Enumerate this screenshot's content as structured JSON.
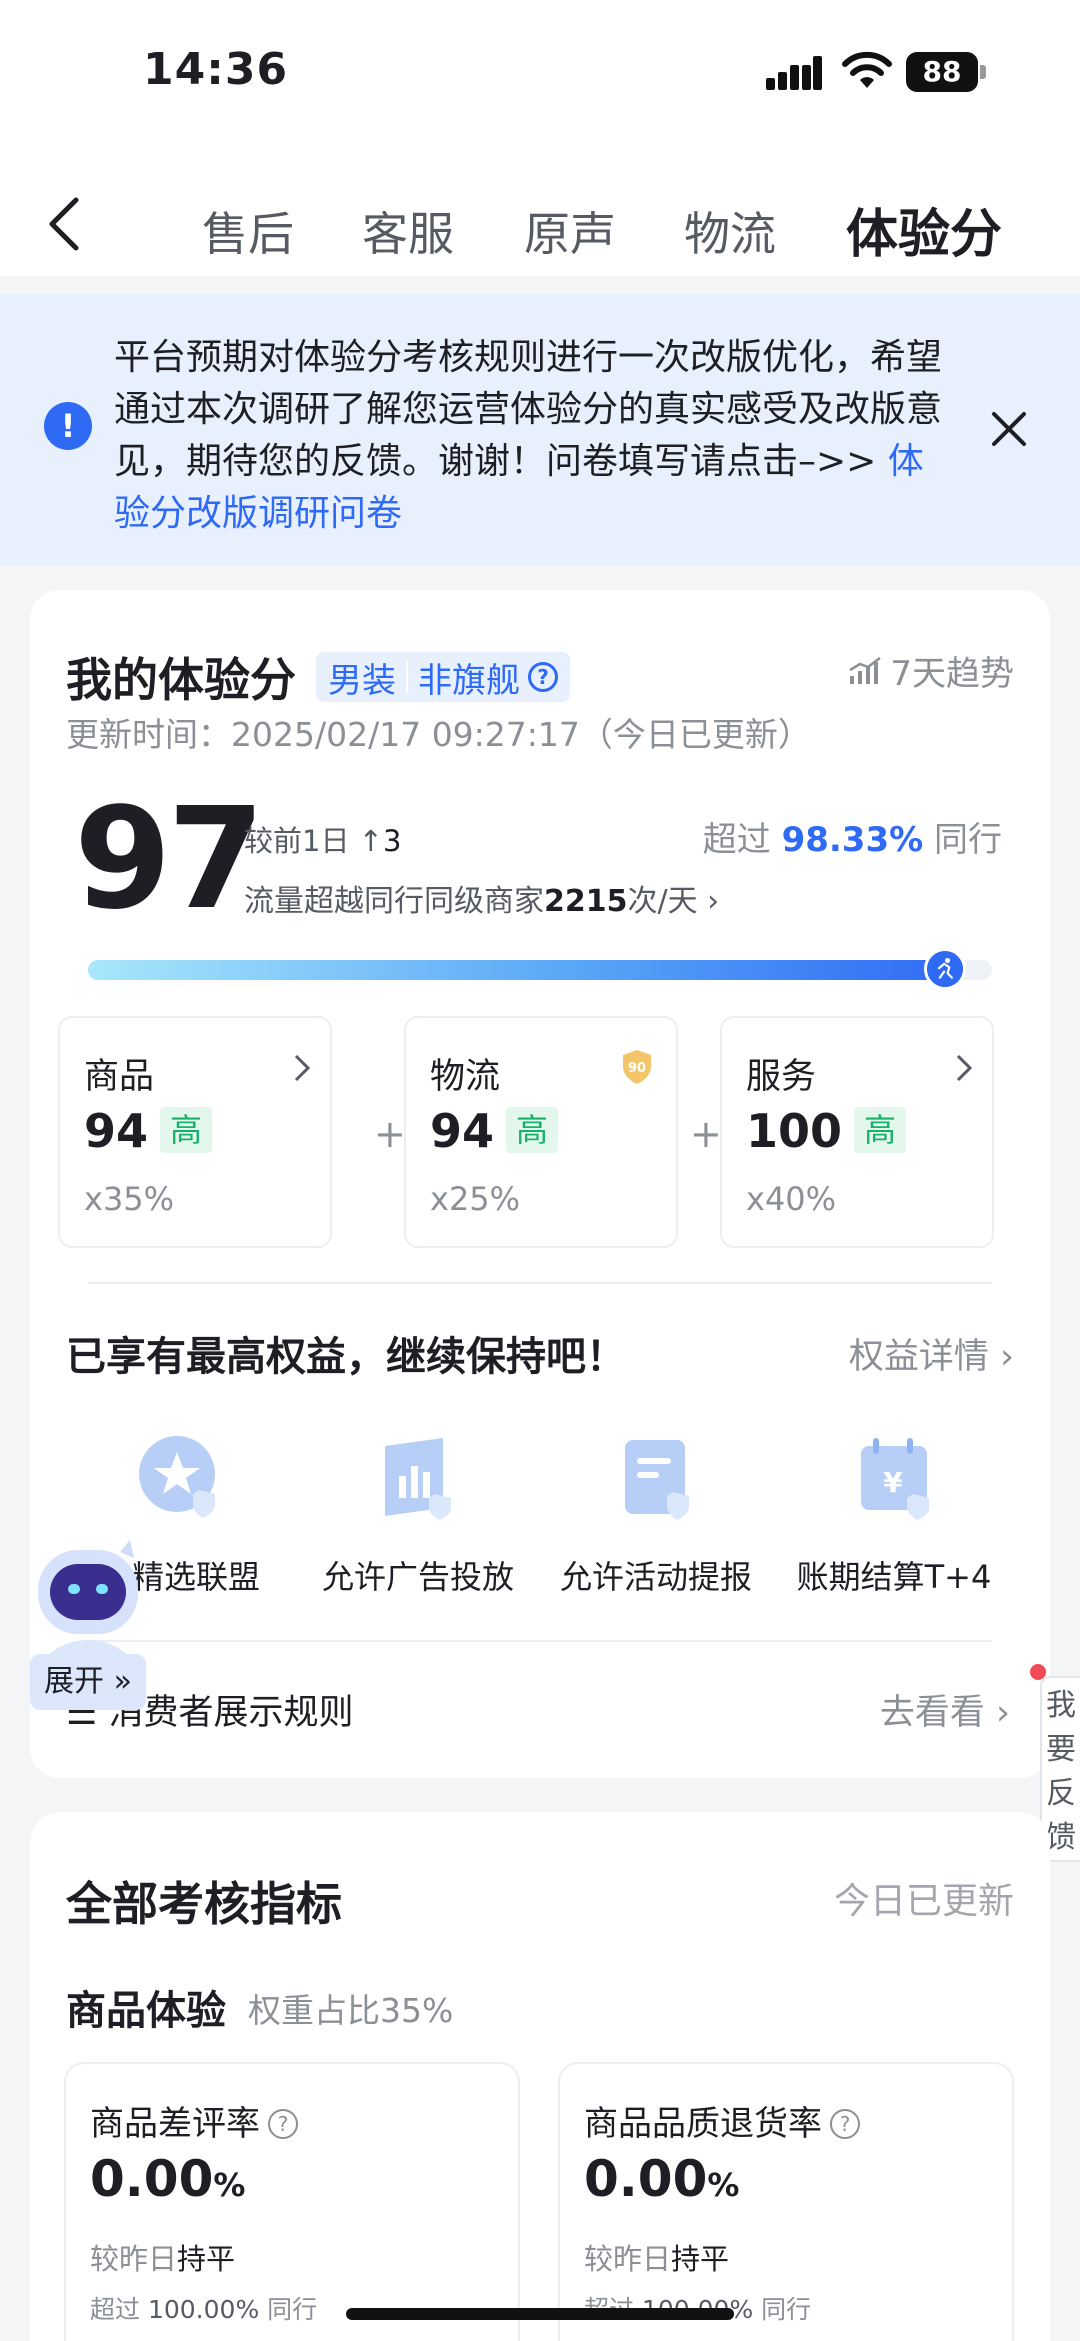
{
  "status_bar": {
    "time": "14:36",
    "battery": "88"
  },
  "nav": {
    "tabs": [
      {
        "label": "售后"
      },
      {
        "label": "客服"
      },
      {
        "label": "原声"
      },
      {
        "label": "物流"
      },
      {
        "label": "体验分",
        "active": true
      }
    ]
  },
  "notice": {
    "text": "平台预期对体验分考核规则进行一次改版优化，希望通过本次调研了解您运营体验分的真实感受及改版意见，期待您的反馈。谢谢！问卷填写请点击–>> ",
    "link": "体验分改版调研问卷"
  },
  "score_card": {
    "title": "我的体验分",
    "category": "男装",
    "store_type": "非旗舰",
    "trend_label": "7天趋势",
    "update_time": "更新时间：2025/02/17 09:27:17（今日已更新）",
    "score": "97",
    "compare_label": "较前1日",
    "compare_value": "3",
    "exceed_prefix": "超过",
    "exceed_pct": "98.33%",
    "exceed_suffix": "同行",
    "traffic_prefix": "流量超越同行同级商家",
    "traffic_value": "2215",
    "traffic_suffix": "次/天",
    "progress": 0.97,
    "sub_scores": [
      {
        "name": "商品",
        "value": "94",
        "level": "高",
        "weight": "x35%"
      },
      {
        "name": "物流",
        "value": "94",
        "level": "高",
        "weight": "x25%",
        "badge": "90"
      },
      {
        "name": "服务",
        "value": "100",
        "level": "高",
        "weight": "x40%"
      }
    ],
    "plus": "+",
    "benefit_title": "已享有最高权益，继续保持吧！",
    "benefit_detail": "权益详情",
    "benefits": [
      {
        "label": "入精选联盟"
      },
      {
        "label": "允许广告投放"
      },
      {
        "label": "允许活动提报"
      },
      {
        "label": "账期结算T+4"
      }
    ],
    "rule_label": "消费者展示规则",
    "rule_action": "去看看"
  },
  "assistant": {
    "expand_label": "展开"
  },
  "feedback": {
    "label": "我要反馈"
  },
  "metrics_card": {
    "title": "全部考核指标",
    "updated": "今日已更新",
    "group_title": "商品体验",
    "group_weight": "权重占比35%",
    "metrics": [
      {
        "name": "商品差评率",
        "value": "0.00",
        "unit": "%",
        "compare_label": "较昨日",
        "compare_value": "持平",
        "exceed_prefix": "超过",
        "exceed_value": "100.00%",
        "exceed_suffix": "同行"
      },
      {
        "name": "商品品质退货率",
        "value": "0.00",
        "unit": "%",
        "compare_label": "较昨日",
        "compare_value": "持平",
        "exceed_prefix": "超过",
        "exceed_value": "100.00%",
        "exceed_suffix": "同行"
      }
    ]
  },
  "colors": {
    "accent": "#2f6af5",
    "level_green": "#17b26a",
    "notice_bg": "#e8f0fd"
  }
}
